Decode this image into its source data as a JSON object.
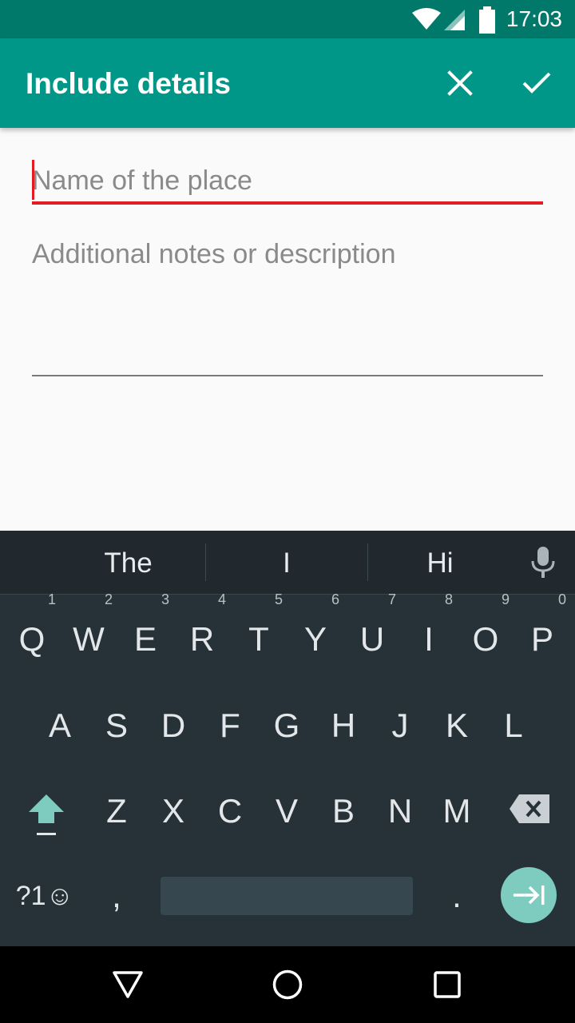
{
  "status_bar": {
    "time": "17:03",
    "icons": [
      "wifi-icon",
      "cell-signal-icon",
      "battery-icon"
    ]
  },
  "app_bar": {
    "title": "Include details",
    "actions": [
      "close-icon",
      "check-icon"
    ]
  },
  "form": {
    "name_placeholder": "Name of the place",
    "notes_placeholder": "Additional notes or description"
  },
  "keyboard": {
    "suggestions": [
      "The",
      "I",
      "Hi"
    ],
    "row1": [
      "Q",
      "W",
      "E",
      "R",
      "T",
      "Y",
      "U",
      "I",
      "O",
      "P"
    ],
    "row1_hints": [
      "1",
      "2",
      "3",
      "4",
      "5",
      "6",
      "7",
      "8",
      "9",
      "0"
    ],
    "row2": [
      "A",
      "S",
      "D",
      "F",
      "G",
      "H",
      "J",
      "K",
      "L"
    ],
    "row3": [
      "Z",
      "X",
      "C",
      "V",
      "B",
      "N",
      "M"
    ],
    "symbols_label": "?1☺",
    "comma": ",",
    "period": ".",
    "icons": [
      "mic-icon",
      "shift-icon",
      "backspace-icon",
      "enter-icon"
    ]
  },
  "nav_bar": {
    "icons": [
      "back-icon",
      "home-icon",
      "recents-icon"
    ]
  },
  "colors": {
    "status_bar": "#00796b",
    "app_bar": "#009688",
    "accent_error": "#e31b23",
    "keyboard_bg": "#263238",
    "enter_key": "#7ecbc0"
  }
}
